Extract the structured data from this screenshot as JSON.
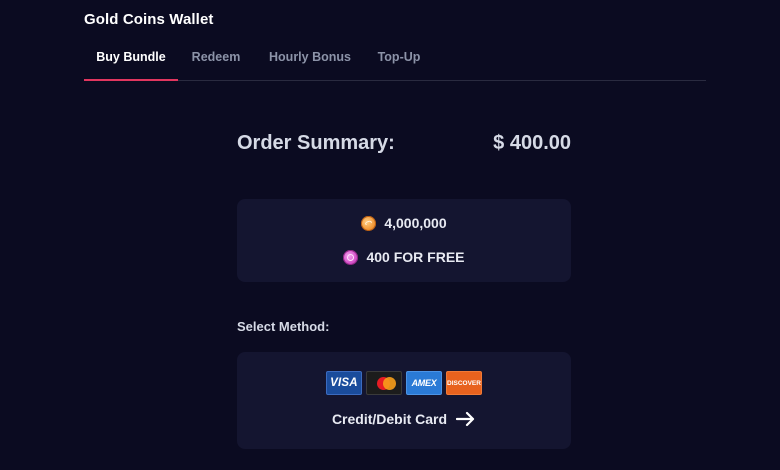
{
  "header": {
    "title": "Gold Coins Wallet"
  },
  "tabs": [
    {
      "label": "Buy Bundle",
      "active": true
    },
    {
      "label": "Redeem",
      "active": false
    },
    {
      "label": "Hourly Bonus",
      "active": false
    },
    {
      "label": "Top-Up",
      "active": false
    }
  ],
  "summary": {
    "label": "Order Summary:",
    "amount": "$ 400.00"
  },
  "bundle": {
    "gold_coins": "4,000,000",
    "gold_icon": "gold-coin-icon",
    "bonus": "400 FOR FREE",
    "bonus_icon": "sweep-coin-icon"
  },
  "method": {
    "label": "Select Method:",
    "card_logos": [
      "VISA",
      "mastercard",
      "AMEX",
      "DISCOVER"
    ],
    "name": "Credit/Debit Card",
    "arrow_icon": "arrow-right-icon"
  },
  "colors": {
    "background": "#0b0b21",
    "card": "#141530",
    "accent": "#e2365f"
  }
}
